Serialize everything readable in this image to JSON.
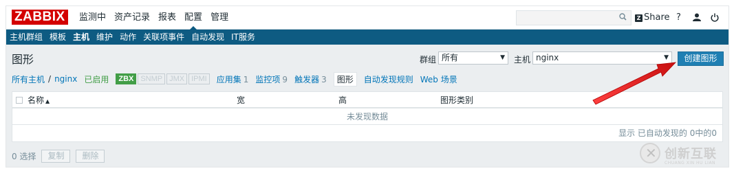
{
  "logo": "ZABBIX",
  "main_menu": [
    "监测中",
    "资产记录",
    "报表",
    "配置",
    "管理"
  ],
  "main_menu_active": "配置",
  "topbar": {
    "search_placeholder": "",
    "share_badge": "Z",
    "share_label": "Share",
    "help": "?",
    "user_icon": "user-icon",
    "logout_icon": "power-icon"
  },
  "sub_menu": [
    "主机群组",
    "模板",
    "主机",
    "维护",
    "动作",
    "关联项事件",
    "自动发现",
    "IT服务"
  ],
  "sub_menu_active": "主机",
  "header": {
    "title": "图形",
    "group_label": "群组",
    "group_value": "所有",
    "host_label": "主机",
    "host_value": "nginx",
    "create_button": "创建图形"
  },
  "host_nav": {
    "all_hosts": "所有主机",
    "slash": "/",
    "host": "nginx",
    "status": "已启用",
    "badges": [
      {
        "label": "ZBX",
        "state": "on"
      },
      {
        "label": "SNMP",
        "state": "off"
      },
      {
        "label": "JMX",
        "state": "off"
      },
      {
        "label": "IPMI",
        "state": "off"
      }
    ],
    "applications": {
      "label": "应用集",
      "count": "1"
    },
    "items": {
      "label": "监控项",
      "count": "9"
    },
    "triggers": {
      "label": "触发器",
      "count": "3"
    },
    "graphs": "图形",
    "discovery": "自动发现规则",
    "web": "Web 场景"
  },
  "table": {
    "columns": [
      "名称",
      "宽",
      "高",
      "图形类别"
    ],
    "sort_indicator": "▲",
    "empty_text": "未发现数据",
    "footer": "显示 已自动发现的 0中的0"
  },
  "actions": {
    "selected": "0 选择",
    "copy": "复制",
    "delete": "删除"
  },
  "watermark": {
    "text": "创新互联",
    "sub": "CHUANG XIN HU LIAN"
  },
  "colors": {
    "logo": "#d40000",
    "submenu": "#0e5b82",
    "button": "#1f7fb3",
    "link": "#0275b8",
    "enabled": "#429e47",
    "arrow": "#e02020"
  }
}
